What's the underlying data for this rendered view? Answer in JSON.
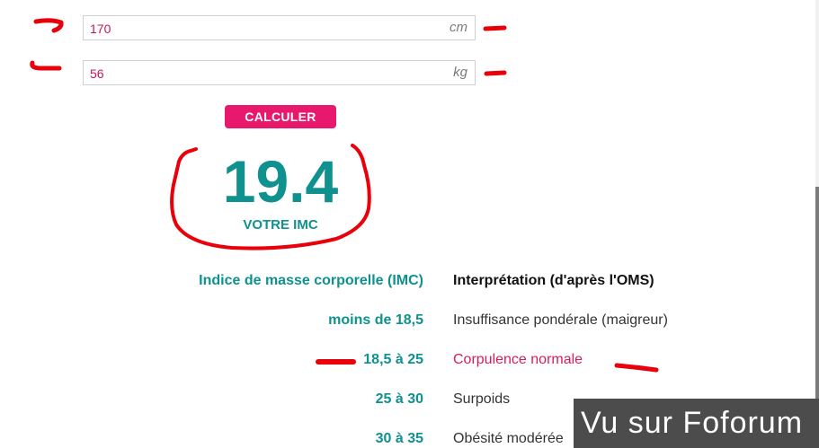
{
  "form": {
    "height": {
      "value": "170",
      "unit": "cm"
    },
    "weight": {
      "value": "56",
      "unit": "kg"
    },
    "submit_label": "CALCULER"
  },
  "result": {
    "value": "19.4",
    "label": "VOTRE IMC"
  },
  "table": {
    "headers": [
      "Indice de masse corporelle (IMC)",
      "Interprétation (d'après l'OMS)"
    ],
    "rows": [
      {
        "range": "moins de 18,5",
        "interpretation": "Insuffisance pondérale (maigreur)"
      },
      {
        "range": "18,5 à 25",
        "interpretation": "Corpulence normale",
        "highlighted": true
      },
      {
        "range": "25 à 30",
        "interpretation": "Surpoids"
      },
      {
        "range": "30 à 35",
        "interpretation": "Obésité modérée"
      }
    ]
  },
  "watermark": {
    "text": "Vu sur Foforum"
  },
  "colors": {
    "accent": "#e8186d",
    "teal": "#0e918f",
    "annotation_red": "#e8000b"
  }
}
